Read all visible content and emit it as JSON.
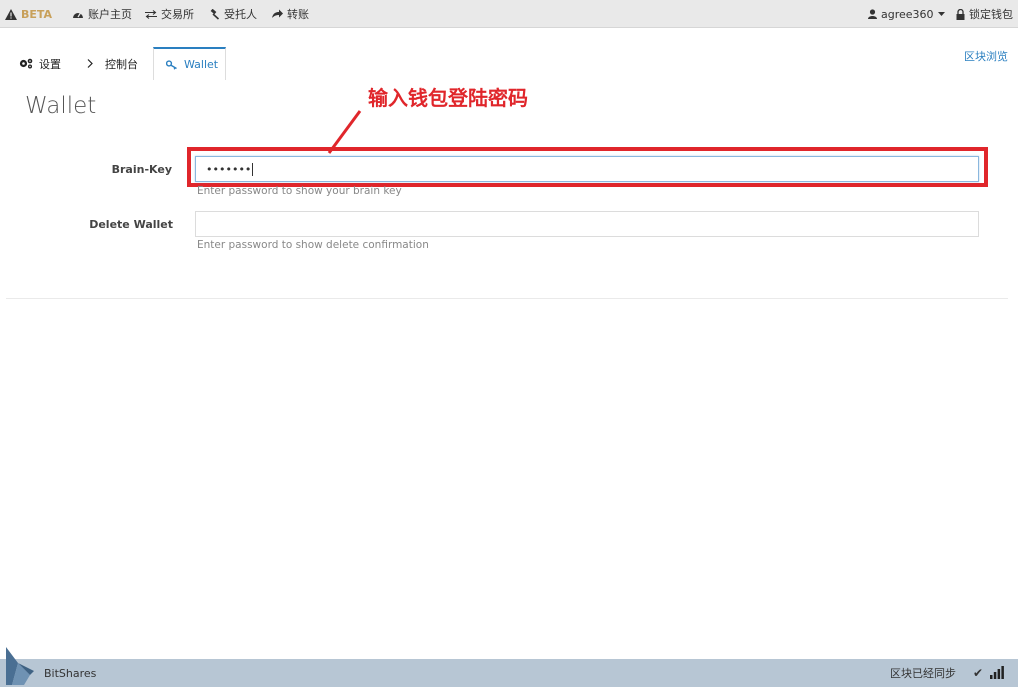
{
  "topnav": {
    "beta_label": "BETA",
    "account_home": "账户主页",
    "exchange": "交易所",
    "delegates": "受托人",
    "transfer": "转账",
    "username": "agree360",
    "lock_wallet": "锁定钱包"
  },
  "tabs": {
    "settings": "设置",
    "console": "控制台",
    "wallet": "Wallet"
  },
  "explorer_link": "区块浏览",
  "page_title": "Wallet",
  "annotation_text": "输入钱包登陆密码",
  "form": {
    "brain_key_label": "Brain-Key",
    "brain_key_value": "•••••••",
    "brain_key_help": "Enter password to show your brain key",
    "delete_wallet_label": "Delete Wallet",
    "delete_wallet_value": "",
    "delete_wallet_help": "Enter password to show delete confirmation"
  },
  "footer": {
    "brand": "BitShares",
    "sync_status": "区块已经同步"
  },
  "colors": {
    "accent": "#2a7fc0",
    "annotation_red": "#e0262b",
    "footer_bg": "#b7c6d4",
    "beta": "#c8a05a"
  }
}
